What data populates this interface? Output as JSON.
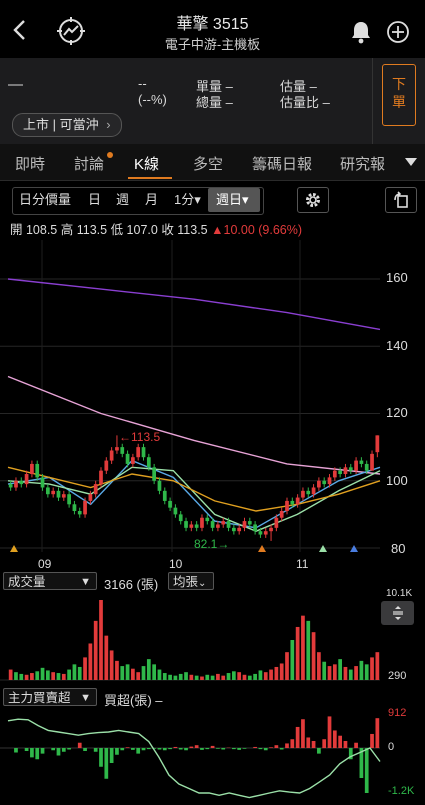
{
  "header": {
    "title": "華擎 3515",
    "subtitle": "電子中游-主機板"
  },
  "quote": {
    "price": "—",
    "change": "--",
    "change_pct": "(--%)",
    "vol_unit_label": "單量 –",
    "vol_total_label": "總量 –",
    "est_vol_label": "估量  –",
    "est_ratio_label": "估量比  –",
    "market_chip": "上市 | 可當沖",
    "sell_button": "下\n單"
  },
  "tabs": [
    "即時",
    "討論",
    "K線",
    "多空",
    "籌碼日報",
    "研究報"
  ],
  "active_tab": "K線",
  "toolbar": {
    "items": [
      "日分價量",
      "日",
      "週",
      "月",
      "1分▾",
      "週日▾"
    ],
    "active": "週日▾"
  },
  "ohlc": {
    "open": "開 108.5",
    "high": "高 113.5",
    "low": "低 107.0",
    "close": "收 113.5",
    "change": "▲10.00 (9.66%)"
  },
  "colors": {
    "up": "#e23b3b",
    "down": "#2fb84a",
    "ma_long": "#8a3fd1",
    "ma_mid": "#e7a3d6",
    "ma_short1": "#5aa9e6",
    "ma_short2": "#9be0a8",
    "ma_short3": "#e0a020",
    "accent": "#e07b20"
  },
  "chart_data": [
    {
      "type": "candlestick",
      "title": "",
      "y_ticks": [
        "160",
        "140",
        "120",
        "100",
        "80"
      ],
      "ylim": [
        80,
        165
      ],
      "x_ticks": [
        "09",
        "10",
        "11"
      ],
      "annotations": [
        {
          "label": "113.5",
          "x_index": 20,
          "value": 113.5
        },
        {
          "label": "82.1",
          "x_index": 49,
          "value": 82.1
        }
      ],
      "candles": [
        [
          99,
          98,
          100,
          97
        ],
        [
          98,
          100,
          101,
          97
        ],
        [
          100,
          99,
          101,
          98
        ],
        [
          99,
          102,
          103,
          98
        ],
        [
          102,
          105,
          106,
          101
        ],
        [
          105,
          101,
          106,
          100
        ],
        [
          101,
          98,
          102,
          97
        ],
        [
          98,
          96,
          99,
          95
        ],
        [
          96,
          97,
          98,
          95
        ],
        [
          97,
          95,
          98,
          94
        ],
        [
          95,
          96,
          97,
          94
        ],
        [
          96,
          93,
          97,
          92
        ],
        [
          93,
          91,
          94,
          90
        ],
        [
          91,
          90,
          92,
          89
        ],
        [
          90,
          94,
          95,
          89
        ],
        [
          94,
          96,
          97,
          93
        ],
        [
          96,
          99,
          100,
          95
        ],
        [
          99,
          103,
          104,
          98
        ],
        [
          103,
          106,
          107,
          102
        ],
        [
          106,
          109,
          110,
          105
        ],
        [
          109,
          110,
          113.5,
          108
        ],
        [
          110,
          108,
          111,
          107
        ],
        [
          108,
          105,
          109,
          104
        ],
        [
          105,
          107,
          108,
          104
        ],
        [
          107,
          110,
          111,
          106
        ],
        [
          110,
          107,
          111,
          106
        ],
        [
          107,
          104,
          108,
          103
        ],
        [
          104,
          100,
          105,
          99
        ],
        [
          100,
          97,
          101,
          96
        ],
        [
          97,
          94,
          98,
          93
        ],
        [
          94,
          92,
          95,
          91
        ],
        [
          92,
          90,
          93,
          89
        ],
        [
          90,
          88,
          91,
          87
        ],
        [
          88,
          86,
          89,
          85
        ],
        [
          86,
          87,
          88,
          85
        ],
        [
          87,
          86,
          88,
          85
        ],
        [
          86,
          89,
          90,
          85
        ],
        [
          89,
          88,
          90,
          87
        ],
        [
          88,
          86,
          89,
          85
        ],
        [
          86,
          87,
          88,
          85
        ],
        [
          87,
          88,
          89,
          86
        ],
        [
          88,
          86,
          89,
          85
        ],
        [
          86,
          85,
          87,
          84
        ],
        [
          85,
          86,
          87,
          84
        ],
        [
          86,
          88,
          89,
          85
        ],
        [
          88,
          87,
          89,
          86
        ],
        [
          87,
          85,
          88,
          84
        ],
        [
          85,
          84,
          86,
          83
        ],
        [
          84,
          85,
          86,
          83
        ],
        [
          85,
          86,
          87,
          82.1
        ],
        [
          86,
          89,
          90,
          85
        ],
        [
          89,
          91,
          92,
          88
        ],
        [
          91,
          94,
          95,
          90
        ],
        [
          94,
          93,
          95,
          92
        ],
        [
          93,
          95,
          96,
          92
        ],
        [
          95,
          97,
          98,
          94
        ],
        [
          97,
          96,
          98,
          95
        ],
        [
          96,
          98,
          99,
          95
        ],
        [
          98,
          100,
          101,
          97
        ],
        [
          100,
          99,
          101,
          98
        ],
        [
          99,
          101,
          102,
          98
        ],
        [
          101,
          103,
          104,
          100
        ],
        [
          103,
          102,
          104,
          101
        ],
        [
          102,
          104,
          105,
          101
        ],
        [
          104,
          103,
          105,
          102
        ],
        [
          103,
          106,
          107,
          102
        ],
        [
          106,
          105,
          107,
          104
        ],
        [
          105,
          103,
          106,
          102
        ],
        [
          103,
          108,
          109,
          103
        ],
        [
          108.5,
          113.5,
          113.5,
          107
        ]
      ],
      "ma_series": [
        {
          "color_key": "ma_long",
          "values": [
            160,
            157,
            154,
            150,
            145
          ]
        },
        {
          "color_key": "ma_mid",
          "values": [
            131,
            120,
            112,
            105,
            102
          ]
        },
        {
          "color_key": "ma_short1",
          "values": [
            99,
            101,
            93,
            106,
            101,
            88,
            86,
            93,
            100,
            104
          ]
        },
        {
          "color_key": "ma_short2",
          "values": [
            100,
            99,
            96,
            104,
            103,
            90,
            85,
            90,
            97,
            103
          ]
        },
        {
          "color_key": "ma_short3",
          "values": [
            104,
            101,
            98,
            102,
            100,
            94,
            91,
            93,
            96,
            100
          ]
        }
      ]
    },
    {
      "type": "bar",
      "title": "成交量",
      "value_text": "3166 (張)",
      "ma_label": "均張",
      "top_label": "10.1K",
      "bottom_label": "290",
      "values": [
        1.2,
        0.9,
        0.7,
        0.6,
        0.8,
        1.0,
        1.4,
        1.1,
        0.9,
        0.8,
        0.7,
        1.2,
        1.8,
        1.5,
        2.6,
        4.2,
        6.8,
        9.2,
        5.1,
        3.4,
        2.2,
        1.6,
        1.8,
        1.3,
        0.9,
        1.6,
        2.4,
        1.8,
        1.2,
        0.8,
        0.6,
        0.5,
        0.7,
        0.9,
        0.6,
        0.5,
        0.4,
        0.6,
        0.5,
        0.7,
        0.5,
        0.8,
        1.0,
        0.9,
        0.6,
        0.5,
        0.7,
        1.1,
        0.9,
        1.2,
        1.5,
        1.9,
        3.2,
        4.6,
        6.1,
        7.4,
        6.8,
        5.5,
        3.2,
        2.1,
        1.6,
        1.8,
        2.4,
        1.5,
        1.2,
        1.6,
        2.2,
        1.8,
        2.6,
        3.2
      ],
      "up_flags": [
        1,
        0,
        0,
        1,
        1,
        0,
        0,
        0,
        1,
        0,
        1,
        0,
        0,
        0,
        1,
        1,
        1,
        1,
        1,
        1,
        1,
        0,
        0,
        1,
        1,
        0,
        0,
        0,
        0,
        0,
        0,
        0,
        0,
        0,
        1,
        0,
        1,
        0,
        0,
        1,
        1,
        0,
        0,
        1,
        1,
        0,
        0,
        0,
        1,
        1,
        1,
        1,
        1,
        0,
        1,
        1,
        0,
        1,
        1,
        0,
        1,
        1,
        0,
        1,
        0,
        1,
        0,
        0,
        1,
        1
      ]
    },
    {
      "type": "bar",
      "title": "主力買賣超",
      "value_text": "買超(張) –",
      "top_label": "912",
      "mid_label": "0",
      "bottom_label": "-1.2K",
      "values": [
        0,
        -120,
        0,
        -80,
        -250,
        -300,
        -150,
        0,
        -60,
        -200,
        -100,
        -40,
        0,
        150,
        -80,
        0,
        -100,
        -500,
        -820,
        -400,
        -180,
        -60,
        20,
        -50,
        -150,
        -60,
        -30,
        -20,
        -40,
        -60,
        -30,
        30,
        -40,
        -60,
        40,
        80,
        -50,
        -30,
        60,
        -20,
        -40,
        10,
        -30,
        -50,
        -20,
        0,
        30,
        -30,
        -60,
        20,
        80,
        -40,
        130,
        250,
        600,
        820,
        300,
        200,
        -150,
        250,
        900,
        500,
        350,
        200,
        -300,
        150,
        -800,
        -1200,
        400,
        850
      ],
      "cum_line": [
        0.85,
        0.9,
        0.88,
        0.7,
        0.55,
        0.5,
        0.45,
        0.4,
        0.45,
        0.48,
        0.5,
        0.55,
        0.5,
        0.45,
        0.2,
        -0.2,
        -0.6,
        -0.8,
        -0.9,
        -1.0,
        -1.0,
        -1.05,
        -1.0,
        -1.05,
        -1.1,
        -1.05,
        -1.0,
        -0.95,
        -0.98,
        -1.0,
        -0.9,
        -0.75,
        -0.6,
        -0.35,
        -0.2,
        -0.1,
        0.0,
        -0.3
      ]
    }
  ],
  "indicator_labels": {
    "vol_select": "成交量",
    "main_select": "主力買賣超"
  }
}
